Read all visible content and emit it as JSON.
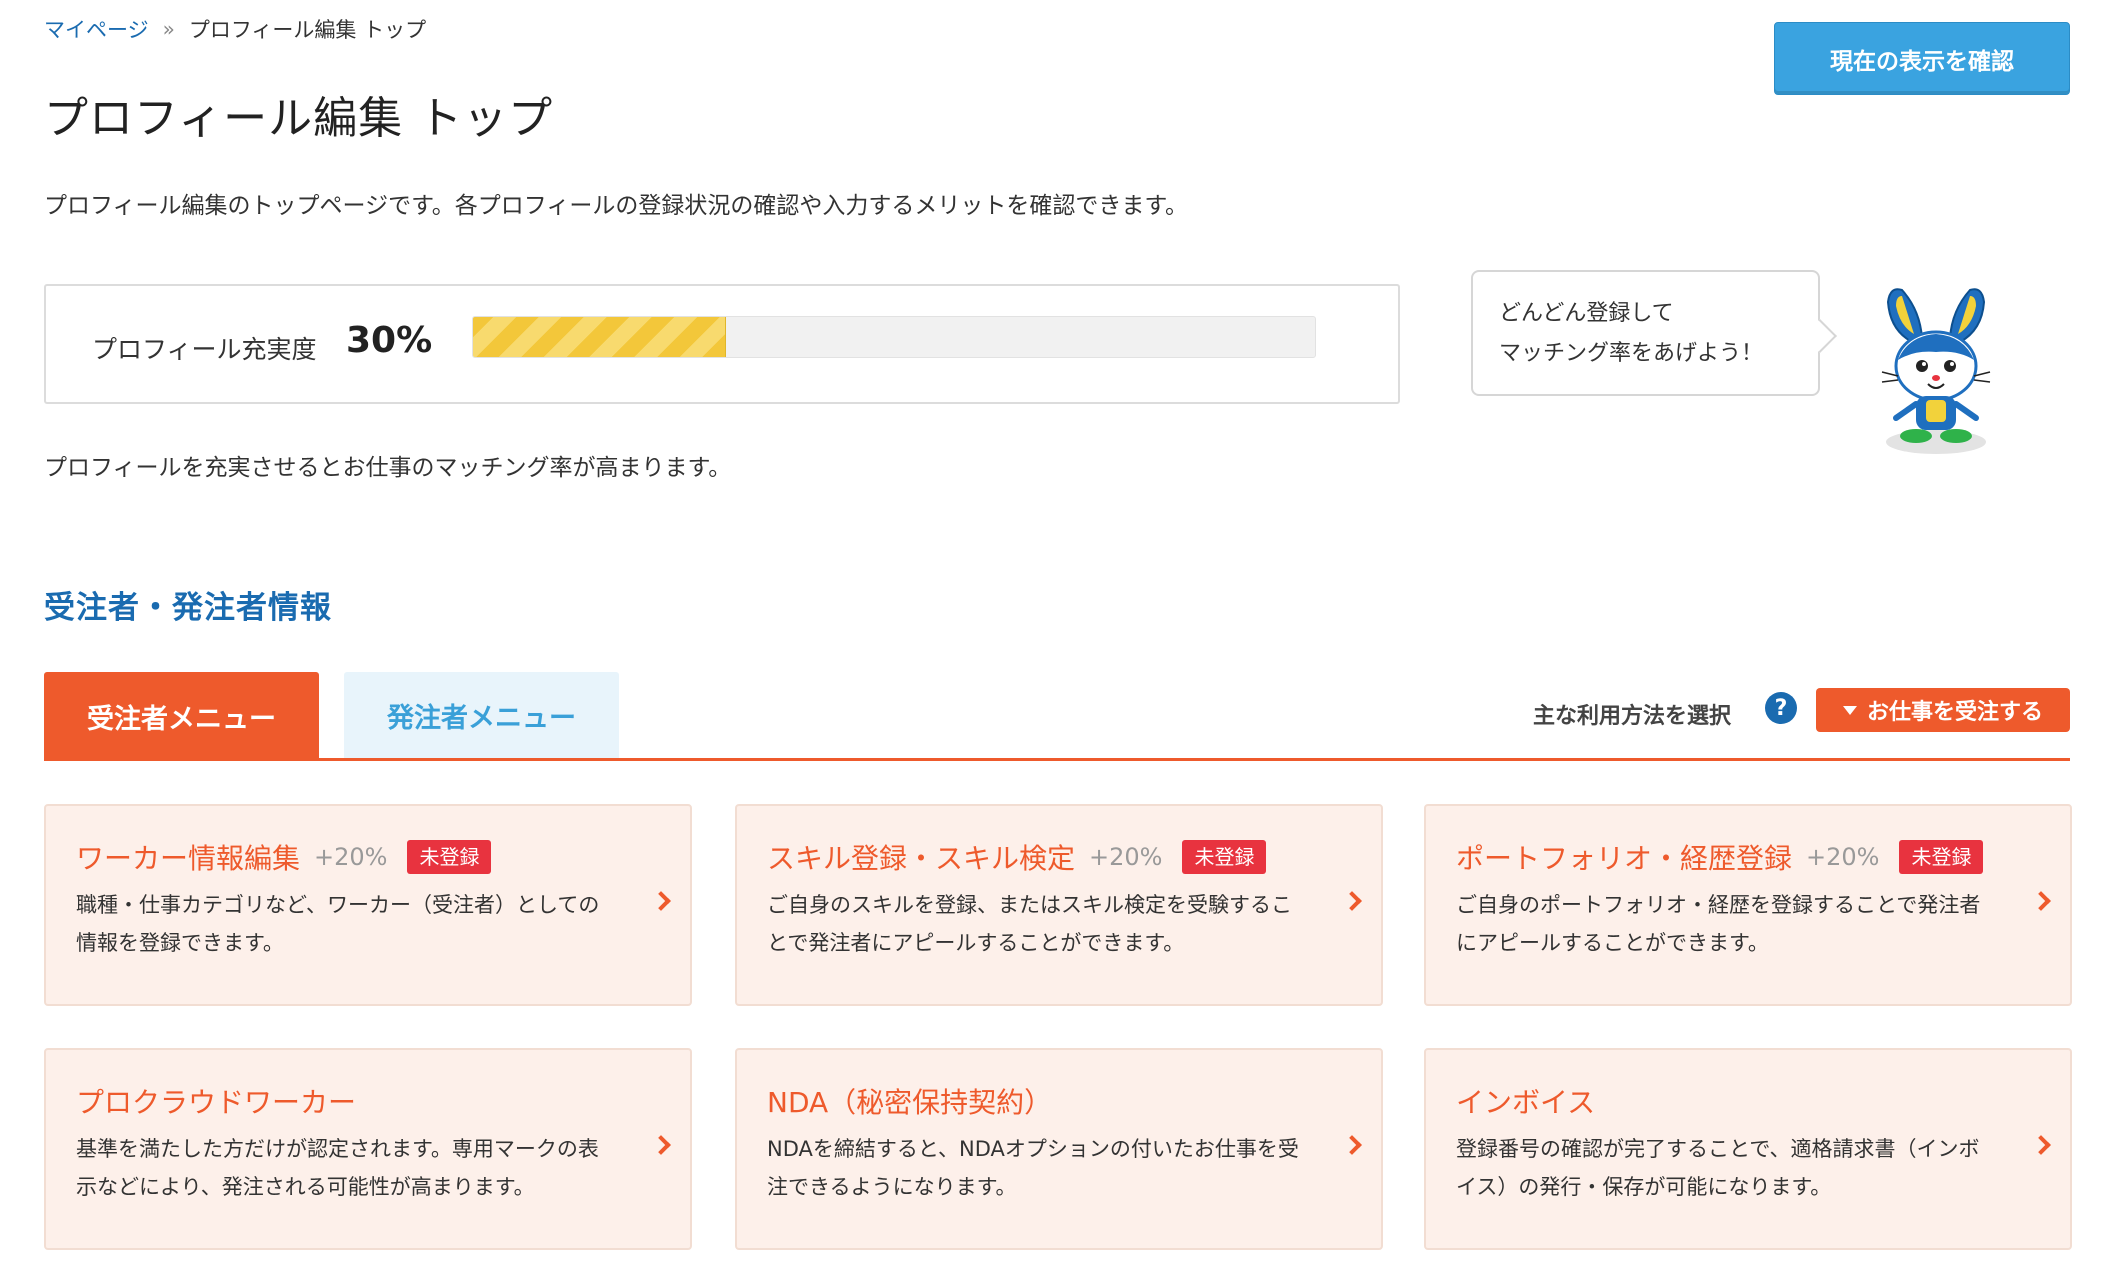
{
  "breadcrumb": {
    "home": "マイページ",
    "separator": "»",
    "current": "プロフィール編集 トップ"
  },
  "header": {
    "title": "プロフィール編集 トップ",
    "confirm_button": "現在の表示を確認",
    "description": "プロフィール編集のトップページです。各プロフィールの登録状況の確認や入力するメリットを確認できます。"
  },
  "progress": {
    "label": "プロフィール充実度",
    "value_text": "30%",
    "percent": 30,
    "note": "プロフィールを充実させるとお仕事のマッチング率が高まります。"
  },
  "mascot": {
    "bubble_line1": "どんどん登録して",
    "bubble_line2": "マッチング率をあげよう！",
    "icon": "rabbit-mascot"
  },
  "section": {
    "title": "受注者・発注者情報"
  },
  "tabs": [
    {
      "label": "受注者メニュー",
      "active": true
    },
    {
      "label": "発注者メニュー",
      "active": false
    }
  ],
  "usage": {
    "label": "主な利用方法を選択",
    "help_icon": "?",
    "selected": "お仕事を受注する"
  },
  "cards": [
    {
      "title": "ワーカー情報編集",
      "bonus": "+20%",
      "badge": "未登録",
      "desc": "職種・仕事カテゴリなど、ワーカー（受注者）としての情報を登録できます。"
    },
    {
      "title": "スキル登録・スキル検定",
      "bonus": "+20%",
      "badge": "未登録",
      "desc": "ご自身のスキルを登録、またはスキル検定を受験することで発注者にアピールすることができます。"
    },
    {
      "title": "ポートフォリオ・経歴登録",
      "bonus": "+20%",
      "badge": "未登録",
      "desc": "ご自身のポートフォリオ・経歴を登録することで発注者にアピールすることができます。"
    },
    {
      "title": "プロクラウドワーカー",
      "bonus": "",
      "badge": "",
      "desc": "基準を満たした方だけが認定されます。専用マークの表示などにより、発注される可能性が高まります。"
    },
    {
      "title": "NDA（秘密保持契約）",
      "bonus": "",
      "badge": "",
      "desc": "NDAを締結すると、NDAオプションの付いたお仕事を受注できるようになります。"
    },
    {
      "title": "インボイス",
      "bonus": "",
      "badge": "",
      "desc": "登録番号の確認が完了することで、適格請求書（インボイス）の発行・保存が可能になります。"
    }
  ],
  "colors": {
    "accent_orange": "#ee5a2c",
    "link_blue": "#1a6bb0",
    "button_blue": "#3aa3e0",
    "badge_red": "#e8333f",
    "card_bg": "#fdf0ea",
    "progress_yellow": "#f3c73a"
  }
}
